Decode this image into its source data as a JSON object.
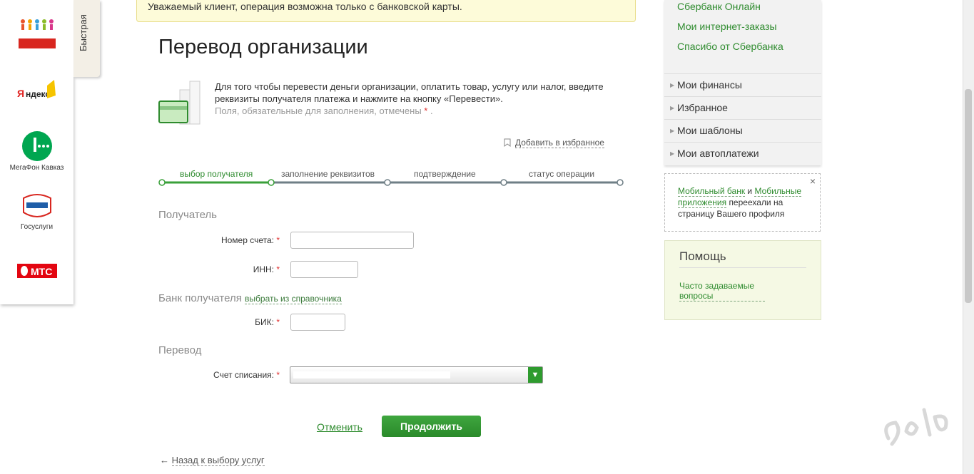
{
  "quick_tab": "Быстрая",
  "partners": [
    {
      "icon": "dom-detey-logo-icon",
      "label": ""
    },
    {
      "icon": "yandex-logo-icon",
      "label": ""
    },
    {
      "icon": "megafon-logo-icon",
      "label": "МегаФон Кавказ"
    },
    {
      "icon": "gosuslugi-logo-icon",
      "label": "Госуслуги"
    },
    {
      "icon": "mts-logo-icon",
      "label": ""
    }
  ],
  "notice": "Уважаемый клиент, операция возможна только с банковской карты.",
  "title": "Перевод организации",
  "intro": {
    "line1": "Для того чтобы перевести деньги организации, оплатить товар, услугу или налог, введите реквизиты получателя платежа и нажмите на кнопку «Перевести».",
    "required": "Поля, обязательные для заполнения, отмечены",
    "required_mark": "*",
    "dot": "."
  },
  "favorite": "Добавить в избранное",
  "steps": [
    {
      "label": "выбор получателя",
      "active": true
    },
    {
      "label": "заполнение реквизитов",
      "active": false
    },
    {
      "label": "подтверждение",
      "active": false
    },
    {
      "label": "статус операции",
      "active": false
    }
  ],
  "sections": {
    "recipient": "Получатель",
    "bank": "Банк получателя",
    "bank_link": "выбрать из справочника",
    "transfer": "Перевод"
  },
  "fields": {
    "account_label": "Номер счета:",
    "inn_label": "ИНН:",
    "bik_label": "БИК:",
    "debit_label": "Счет списания:",
    "required_mark": "*"
  },
  "buttons": {
    "cancel": "Отменить",
    "continue": "Продолжить"
  },
  "back": {
    "arrow": "←",
    "label": "Назад к выбору услуг"
  },
  "right_links": [
    "Сбербанк Онлайн",
    "Мои интернет-заказы",
    "Спасибо от Сбербанка"
  ],
  "right_menu": [
    "Мои финансы",
    "Избранное",
    "Мои шаблоны",
    "Мои автоплатежи"
  ],
  "info_box": {
    "link1": "Мобильный банк",
    "and": "и",
    "link2": "Мобильные приложения",
    "rest": "переехали на страницу Вашего профиля",
    "close": "×"
  },
  "help": {
    "title": "Помощь",
    "faq": "Часто задаваемые вопросы"
  },
  "colors": {
    "accent": "#2e8b2e",
    "notice_bg": "#fdfbd9",
    "help_bg": "#f5f9e4"
  }
}
